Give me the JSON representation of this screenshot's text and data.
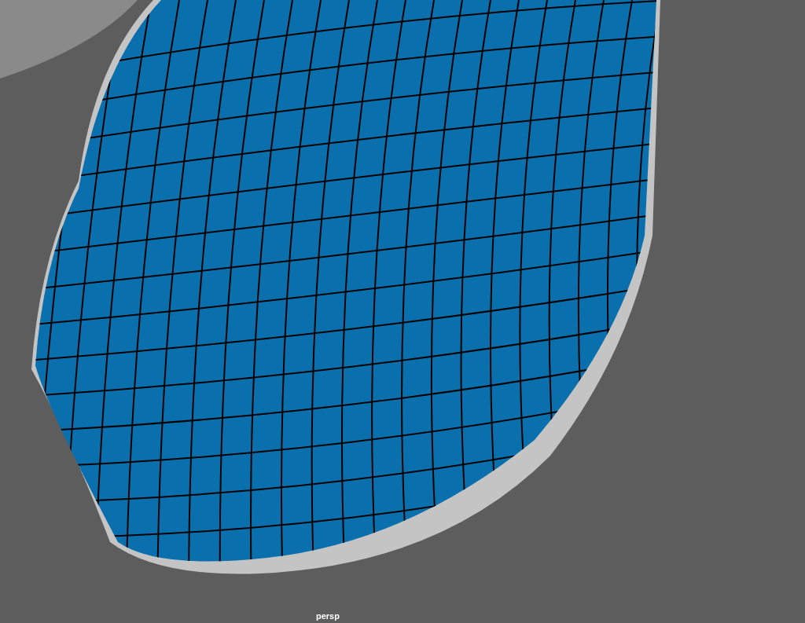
{
  "viewport": {
    "camera_label": "persp"
  }
}
